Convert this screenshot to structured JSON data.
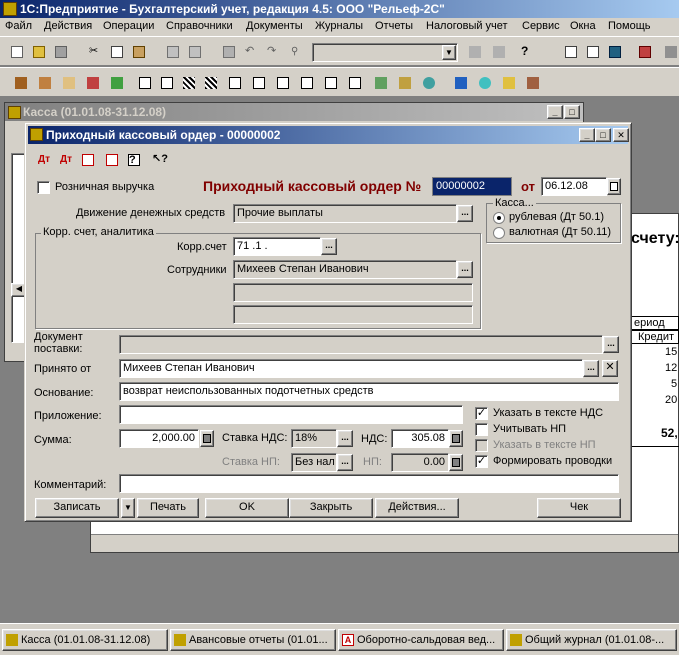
{
  "app": {
    "title": "1С:Предприятие - Бухгалтерский учет, редакция 4.5: ООО \"Рельеф-2С\""
  },
  "menu": [
    "Файл",
    "Действия",
    "Операции",
    "Справочники",
    "Документы",
    "Журналы",
    "Отчеты",
    "Налоговый учет",
    "Сервис",
    "Окна",
    "Помощь"
  ],
  "kassa_window": {
    "title": "Касса (01.01.08-31.12.08)"
  },
  "osv_window": {
    "partial_heading": "счету:",
    "partial_col_period": "ериод",
    "partial_col_credit": "Кредит",
    "partial_values": [
      "15",
      "12",
      "5",
      "20",
      "52,"
    ]
  },
  "dialog": {
    "title": "Приходный кассовый ордер - 00000002",
    "retail_label": "Розничная выручка",
    "retail_checked": false,
    "doc_heading": "Приходный кассовый ордер №",
    "doc_number": "00000002",
    "from_label": "от",
    "doc_date": "06.12.08",
    "cash_flow_label": "Движение денежных средств",
    "cash_flow_value": "Прочие выплаты",
    "kassa_group_title": "Касса...",
    "kassa_options": [
      {
        "label": "рублевая (Дт 50.1)",
        "selected": true
      },
      {
        "label": "валютная (Дт 50.11)",
        "selected": false
      }
    ],
    "corr_group_title": "Корр. счет, аналитика",
    "corr_account_label": "Корр.счет",
    "corr_account_value": "71 .1 .",
    "employees_label": "Сотрудники",
    "employees_value": "Михеев Степан Иванович",
    "analytic2_value": "",
    "analytic3_value": "",
    "supply_doc_label": "Документ поставки:",
    "supply_doc_value": "",
    "received_from_label": "Принято от",
    "received_from_value": "Михеев Степан Иванович",
    "basis_label": "Основание:",
    "basis_value": "возврат неиспользованных подотчетных средств",
    "attachment_label": "Приложение:",
    "attachment_value": "",
    "amount_label": "Сумма:",
    "amount_value": "2,000.00",
    "vat_rate_label": "Ставка НДС:",
    "vat_rate_value": "18%",
    "vat_label": "НДС:",
    "vat_value": "305.08",
    "sales_tax_rate_label": "Ставка НП:",
    "sales_tax_rate_value": "Без нал",
    "sales_tax_label": "НП:",
    "sales_tax_value": "0.00",
    "checks": [
      {
        "label": "Указать в тексте НДС",
        "checked": true,
        "disabled": false
      },
      {
        "label": "Учитывать НП",
        "checked": false,
        "disabled": false
      },
      {
        "label": "Указать в тексте НП",
        "checked": false,
        "disabled": true
      },
      {
        "label": "Формировать проводки",
        "checked": true,
        "disabled": false
      }
    ],
    "comment_label": "Комментарий:",
    "comment_value": "",
    "buttons": {
      "save": "Записать",
      "print": "Печать",
      "ok": "OK",
      "close": "Закрыть",
      "actions": "Действия...",
      "receipt": "Чек"
    }
  },
  "taskbar": [
    "Касса (01.01.08-31.12.08)",
    "Авансовые отчеты (01.01...",
    "Оборотно-сальдовая вед...",
    "Общий журнал (01.01.08-..."
  ],
  "colors": {
    "title_active": "#0a246a",
    "title_inactive": "#808080",
    "face": "#d4d0c8",
    "heading_red": "#800000",
    "selection": "#0a246a"
  }
}
